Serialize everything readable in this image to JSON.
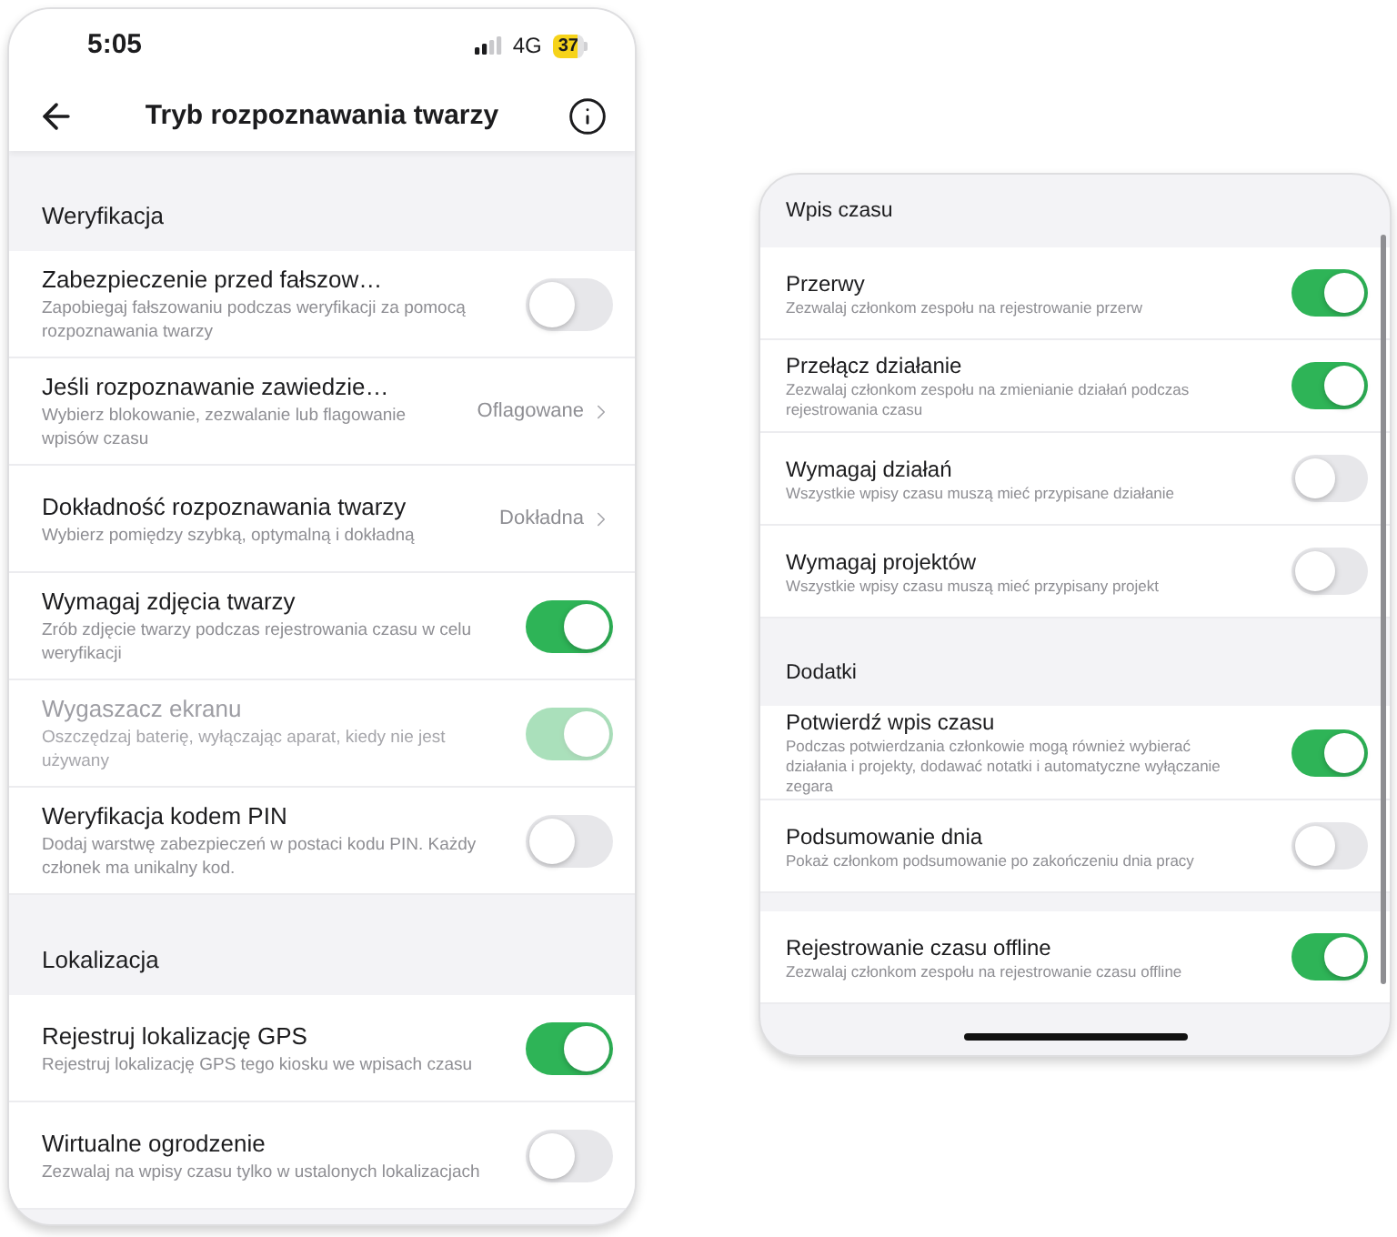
{
  "status_bar": {
    "time": "5:05",
    "network": "4G",
    "battery": "37"
  },
  "header": {
    "title": "Tryb rozpoznawania twarzy"
  },
  "sections": [
    {
      "title": "Weryfikacja",
      "items": [
        {
          "kind": "toggle",
          "title": "Zabezpieczenie przed fałszow…",
          "description": "Zapobiegaj fałszowaniu podczas weryfikacji za pomocą rozpoznawania twarzy",
          "on": false,
          "disabled": false
        },
        {
          "kind": "option",
          "title": "Jeśli rozpoznawanie zawiedzie…",
          "description": "Wybierz blokowanie, zezwalanie lub flagowanie wpisów czasu",
          "value": "Oflagowane",
          "disabled": false
        },
        {
          "kind": "option",
          "title": "Dokładność rozpoznawania twarzy",
          "description": "Wybierz pomiędzy szybką, optymalną i dokładną",
          "value": "Dokładna",
          "disabled": false
        },
        {
          "kind": "toggle",
          "title": "Wymagaj zdjęcia twarzy",
          "description": "Zrób zdjęcie twarzy podczas rejestrowania czasu w celu weryfikacji",
          "on": true,
          "disabled": false
        },
        {
          "kind": "toggle",
          "title": "Wygaszacz ekranu",
          "description": "Oszczędzaj baterię, wyłączając aparat, kiedy nie jest używany",
          "on": true,
          "disabled": true
        },
        {
          "kind": "toggle",
          "title": "Weryfikacja kodem PIN",
          "description": "Dodaj warstwę zabezpieczeń w postaci kodu PIN. Każdy członek ma unikalny kod.",
          "on": false,
          "disabled": false
        }
      ]
    },
    {
      "title": "Lokalizacja",
      "items": [
        {
          "kind": "toggle",
          "title": "Rejestruj lokalizację GPS",
          "description": "Rejestruj lokalizację GPS tego kiosku we wpisach czasu",
          "on": true,
          "disabled": false
        },
        {
          "kind": "toggle",
          "title": "Wirtualne ogrodzenie",
          "description": "Zezwalaj na wpisy czasu tylko w ustalonych lokalizacjach",
          "on": false,
          "disabled": false
        }
      ]
    }
  ],
  "panel": {
    "sections": [
      {
        "title": "Wpis czasu",
        "items": [
          {
            "title": "Przerwy",
            "description": "Zezwalaj członkom zespołu na rejestrowanie przerw",
            "on": true
          },
          {
            "title": "Przełącz działanie",
            "description": "Zezwalaj członkom zespołu na zmienianie działań podczas rejestrowania czasu",
            "on": true
          },
          {
            "title": "Wymagaj działań",
            "description": "Wszystkie wpisy czasu muszą mieć przypisane działanie",
            "on": false
          },
          {
            "title": "Wymagaj projektów",
            "description": "Wszystkie wpisy czasu muszą mieć przypisany projekt",
            "on": false
          }
        ]
      },
      {
        "title": "Dodatki",
        "items": [
          {
            "title": "Potwierdź wpis czasu",
            "description": "Podczas potwierdzania członkowie mogą również wybierać działania i projekty, dodawać notatki i automatyczne wyłączanie zegara",
            "on": true
          },
          {
            "title": "Podsumowanie dnia",
            "description": "Pokaż członkom podsumowanie po zakończeniu dnia pracy",
            "on": false
          }
        ]
      },
      {
        "items": [
          {
            "title": "Rejestrowanie czasu offline",
            "description": "Zezwalaj członkom zespołu na rejestrowanie czasu offline",
            "on": true
          }
        ]
      }
    ]
  }
}
